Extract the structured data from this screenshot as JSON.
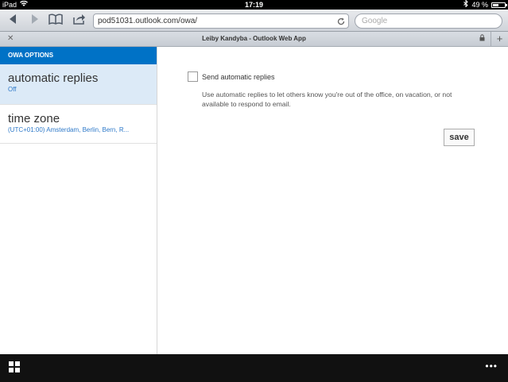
{
  "status_bar": {
    "device": "iPad",
    "time": "17:19",
    "battery_percent_label": "49 %",
    "battery_level": 0.49
  },
  "browser": {
    "url": "pod51031.outlook.com/owa/",
    "search_placeholder": "Google",
    "tab_title": "Leiby Kandyba - Outlook Web App"
  },
  "sidebar": {
    "header": "OWA OPTIONS",
    "items": [
      {
        "title": "automatic replies",
        "subtitle": "Off",
        "selected": true
      },
      {
        "title": "time zone",
        "subtitle": "(UTC+01:00) Amsterdam, Berlin, Bern, R...",
        "selected": false
      }
    ]
  },
  "main": {
    "checkbox_label": "Send automatic replies",
    "checkbox_checked": false,
    "description": "Use automatic replies to let others know you're out of the office, on vacation, or not available to respond to email.",
    "save_label": "save"
  },
  "colors": {
    "accent": "#0072c6",
    "selected_bg": "#dceaf7",
    "link": "#2f7ac9",
    "bottom_bar": "#111111"
  },
  "icons": {
    "home": "windows-grid-icon",
    "more": "ellipsis-icon"
  }
}
